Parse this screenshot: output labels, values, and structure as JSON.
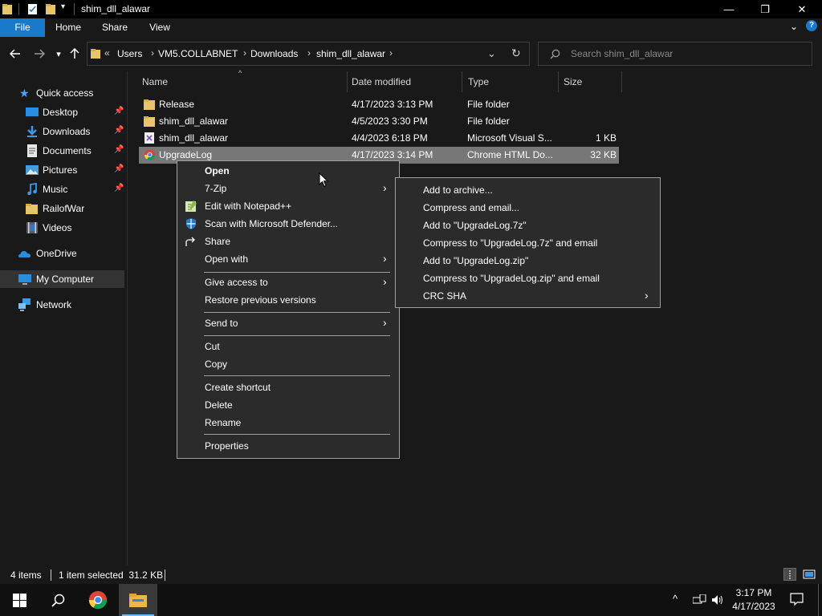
{
  "window": {
    "title": "shim_dll_alawar",
    "controls": {
      "minimize": "—",
      "maximize": "❐",
      "close": "✕"
    }
  },
  "ribbon": {
    "tabs": [
      "File",
      "Home",
      "Share",
      "View"
    ],
    "accent": "#1979ca"
  },
  "addressbar": {
    "overflow": "«",
    "crumbs": [
      "Users",
      "VM5.COLLABNET",
      "Downloads",
      "shim_dll_alawar"
    ],
    "separator": "›"
  },
  "search": {
    "placeholder": "Search shim_dll_alawar"
  },
  "nav": {
    "items": [
      {
        "label": "Quick access",
        "icon": "star-icon",
        "pinned": false
      },
      {
        "label": "Desktop",
        "icon": "desktop-icon",
        "pinned": true
      },
      {
        "label": "Downloads",
        "icon": "download-icon",
        "pinned": true
      },
      {
        "label": "Documents",
        "icon": "documents-icon",
        "pinned": true
      },
      {
        "label": "Pictures",
        "icon": "pictures-icon",
        "pinned": true
      },
      {
        "label": "Music",
        "icon": "music-icon",
        "pinned": true
      },
      {
        "label": "RailofWar",
        "icon": "folder-icon",
        "pinned": false
      },
      {
        "label": "Videos",
        "icon": "videos-icon",
        "pinned": false
      },
      {
        "label": "OneDrive",
        "icon": "onedrive-icon",
        "pinned": false
      },
      {
        "label": "My Computer",
        "icon": "computer-icon",
        "pinned": false,
        "selected": true
      },
      {
        "label": "Network",
        "icon": "network-icon",
        "pinned": false
      }
    ]
  },
  "columns": {
    "name": "Name",
    "date": "Date modified",
    "type": "Type",
    "size": "Size"
  },
  "files": [
    {
      "name": "Release",
      "date": "4/17/2023 3:13 PM",
      "type": "File folder",
      "size": "",
      "icon": "folder-icon"
    },
    {
      "name": "shim_dll_alawar",
      "date": "4/5/2023 3:30 PM",
      "type": "File folder",
      "size": "",
      "icon": "folder-icon"
    },
    {
      "name": "shim_dll_alawar",
      "date": "4/4/2023 6:18 PM",
      "type": "Microsoft Visual S...",
      "size": "1 KB",
      "icon": "vs-solution-icon"
    },
    {
      "name": "UpgradeLog",
      "date": "4/17/2023 3:14 PM",
      "type": "Chrome HTML Do...",
      "size": "32 KB",
      "icon": "chrome-icon",
      "selected": true
    }
  ],
  "context_menu": {
    "open": "Open",
    "zip": "7-Zip",
    "notepad": "Edit with Notepad++",
    "defender": "Scan with Microsoft Defender...",
    "share": "Share",
    "open_with": "Open with",
    "give_access": "Give access to",
    "restore": "Restore previous versions",
    "send_to": "Send to",
    "cut": "Cut",
    "copy": "Copy",
    "create_shortcut": "Create shortcut",
    "delete": "Delete",
    "rename": "Rename",
    "properties": "Properties"
  },
  "zip_menu": [
    "Add to archive...",
    "Compress and email...",
    "Add to \"UpgradeLog.7z\"",
    "Compress to \"UpgradeLog.7z\" and email",
    "Add to \"UpgradeLog.zip\"",
    "Compress to \"UpgradeLog.zip\" and email",
    "CRC SHA"
  ],
  "status": {
    "count": "4 items",
    "selected": "1 item selected  31.2 KB"
  },
  "clock": {
    "time": "3:17 PM",
    "date": "4/17/2023"
  }
}
